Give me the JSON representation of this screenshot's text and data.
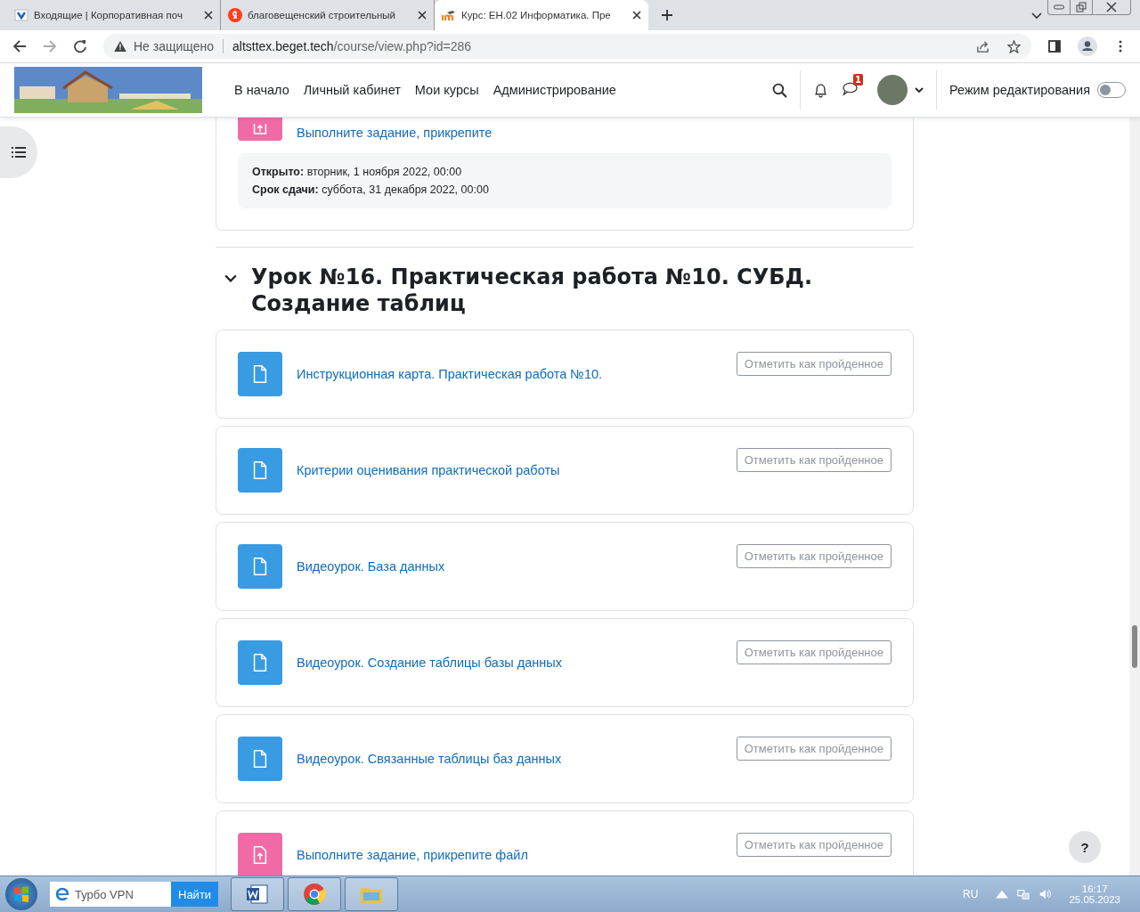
{
  "browser": {
    "tabs": [
      {
        "title": "Входящие | Корпоративная поч",
        "selected": false
      },
      {
        "title": "благовещенский строительный",
        "selected": false
      },
      {
        "title": "Курс: ЕН.02 Информатика. Пре",
        "selected": true
      }
    ],
    "security": "Не защищено",
    "url_host": "altsttex.beget.tech",
    "url_path": "/course/view.php?id=286"
  },
  "header": {
    "nav": [
      "В начало",
      "Личный кабинет",
      "Мои курсы",
      "Администрирование"
    ],
    "messages_badge": "1",
    "edit_mode_label": "Режим редактирования",
    "edit_mode_on": false
  },
  "top_activity": {
    "title": "Выполните задание, прикрепите",
    "kind": "assign",
    "dates": [
      {
        "label": "Открыто:",
        "value": "вторник, 1 ноября 2022, 00:00"
      },
      {
        "label": "Срок сдачи:",
        "value": "суббота, 31 декабря 2022, 00:00"
      }
    ]
  },
  "section": {
    "title": "Урок №16. Практическая работа №10. СУБД. Создание таблиц",
    "expanded": true,
    "activities": [
      {
        "title": "Инструкционная карта. Практическая работа №10.",
        "kind": "file",
        "button": "Отметить как пройденное"
      },
      {
        "title": "Критерии оценивания практической работы",
        "kind": "file",
        "button": "Отметить как пройденное"
      },
      {
        "title": "Видеоурок. База данных",
        "kind": "file",
        "button": "Отметить как пройденное"
      },
      {
        "title": "Видеоурок. Создание таблицы базы данных",
        "kind": "file",
        "button": "Отметить как пройденное"
      },
      {
        "title": "Видеоурок. Связанные таблицы баз данных",
        "kind": "file",
        "button": "Отметить как пройденное"
      },
      {
        "title": "Выполните задание, прикрепите файл",
        "kind": "assign",
        "button": "Отметить как пройденное"
      }
    ]
  },
  "help_button": "?",
  "taskbar": {
    "search_value": "Турбо VPN",
    "search_button": "Найти",
    "language": "RU",
    "time": "16:17",
    "date": "25.05.2023"
  }
}
